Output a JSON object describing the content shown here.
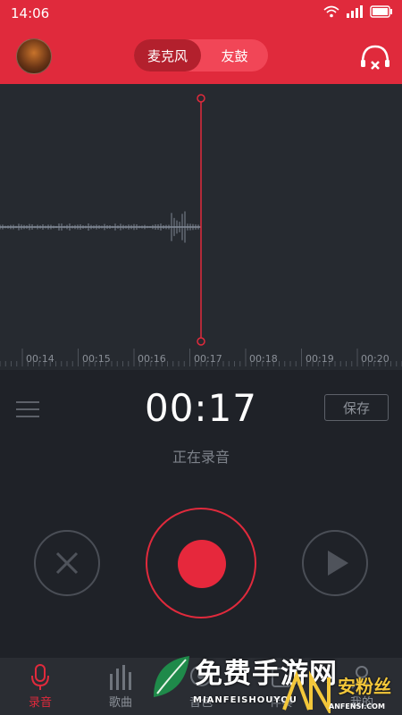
{
  "status_bar": {
    "time": "14:06"
  },
  "header": {
    "tabs": [
      {
        "label": "麦克风",
        "active": true
      },
      {
        "label": "友鼓",
        "active": false
      }
    ]
  },
  "timeline": {
    "ticks": [
      "00:14",
      "00:15",
      "00:16",
      "00:17",
      "00:18",
      "00:19",
      "00:20"
    ]
  },
  "recorder": {
    "elapsed": "00:17",
    "state_text": "正在录音",
    "save_label": "保存"
  },
  "bottom_nav": {
    "items": [
      {
        "label": "录音",
        "icon": "mic-icon",
        "active": true
      },
      {
        "label": "歌曲",
        "icon": "bars-icon",
        "active": false
      },
      {
        "label": "音色",
        "icon": "tone-icon",
        "active": false
      },
      {
        "label": "伴奏",
        "icon": "accompany-icon",
        "active": false
      },
      {
        "label": "我的",
        "icon": "user-icon",
        "active": false
      }
    ]
  },
  "watermark": {
    "title": "免费手游网",
    "subtitle": "MIANFEISHOUYOU",
    "brand": "安粉丝",
    "domain": "ANFENSI.COM"
  },
  "colors": {
    "accent": "#e02a3c",
    "panel": "#1f2228",
    "wave_bg": "#262a30"
  }
}
